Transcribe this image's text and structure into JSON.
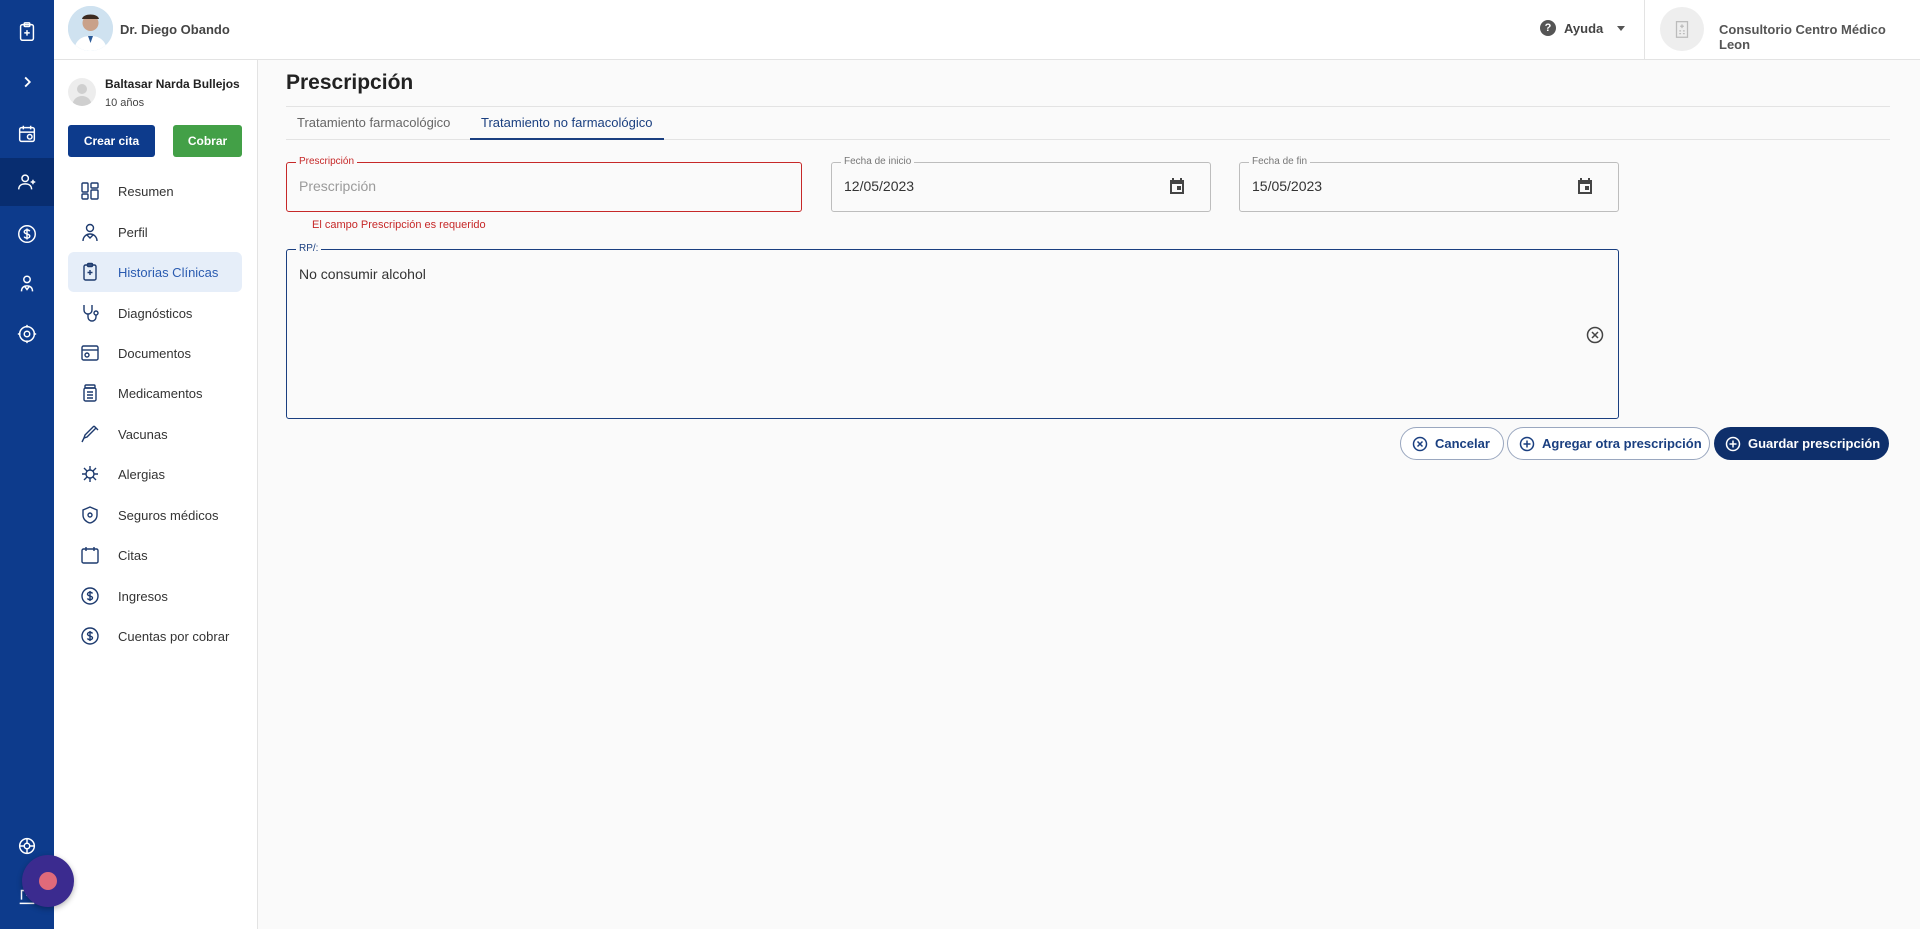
{
  "header": {
    "doctor_name": "Dr. Diego Obando",
    "help_label": "Ayuda",
    "clinic_name": "Consultorio Centro Médico Leon"
  },
  "patient": {
    "name": "Baltasar Narda Bullejos",
    "age": "10 años",
    "create_appointment_label": "Crear cita",
    "charge_label": "Cobrar"
  },
  "nav": {
    "items": [
      {
        "label": "Resumen",
        "icon": "dashboard-icon",
        "active": false
      },
      {
        "label": "Perfil",
        "icon": "profile-icon",
        "active": false
      },
      {
        "label": "Historias Clínicas",
        "icon": "clinical-history-icon",
        "active": true
      },
      {
        "label": "Diagnósticos",
        "icon": "stethoscope-icon",
        "active": false
      },
      {
        "label": "Documentos",
        "icon": "documents-icon",
        "active": false
      },
      {
        "label": "Medicamentos",
        "icon": "medicine-icon",
        "active": false
      },
      {
        "label": "Vacunas",
        "icon": "syringe-icon",
        "active": false
      },
      {
        "label": "Alergias",
        "icon": "allergy-icon",
        "active": false
      },
      {
        "label": "Seguros médicos",
        "icon": "insurance-icon",
        "active": false
      },
      {
        "label": "Citas",
        "icon": "calendar-icon",
        "active": false
      },
      {
        "label": "Ingresos",
        "icon": "dollar-icon",
        "active": false
      },
      {
        "label": "Cuentas por cobrar",
        "icon": "dollar-icon",
        "active": false
      }
    ]
  },
  "main": {
    "title": "Prescripción",
    "tabs": [
      {
        "label": "Tratamiento farmacológico",
        "active": false
      },
      {
        "label": "Tratamiento no farmacológico",
        "active": true
      }
    ],
    "prescription": {
      "label": "Prescripción",
      "placeholder": "Prescripción",
      "value": "",
      "error": "El campo Prescripción es requerido"
    },
    "start_date": {
      "label": "Fecha de inicio",
      "value": "12/05/2023"
    },
    "end_date": {
      "label": "Fecha de fin",
      "value": "15/05/2023"
    },
    "rp": {
      "label": "RP/:",
      "value": "No consumir alcohol"
    },
    "actions": {
      "cancel": "Cancelar",
      "add_another": "Agregar otra prescripción",
      "save": "Guardar prescripción"
    }
  },
  "colors": {
    "rail": "#0d3b8c",
    "primary_button": "#0e2f6b",
    "charge_button": "#43a047",
    "error": "#c62828",
    "active_nav_bg": "#e6eef9"
  }
}
